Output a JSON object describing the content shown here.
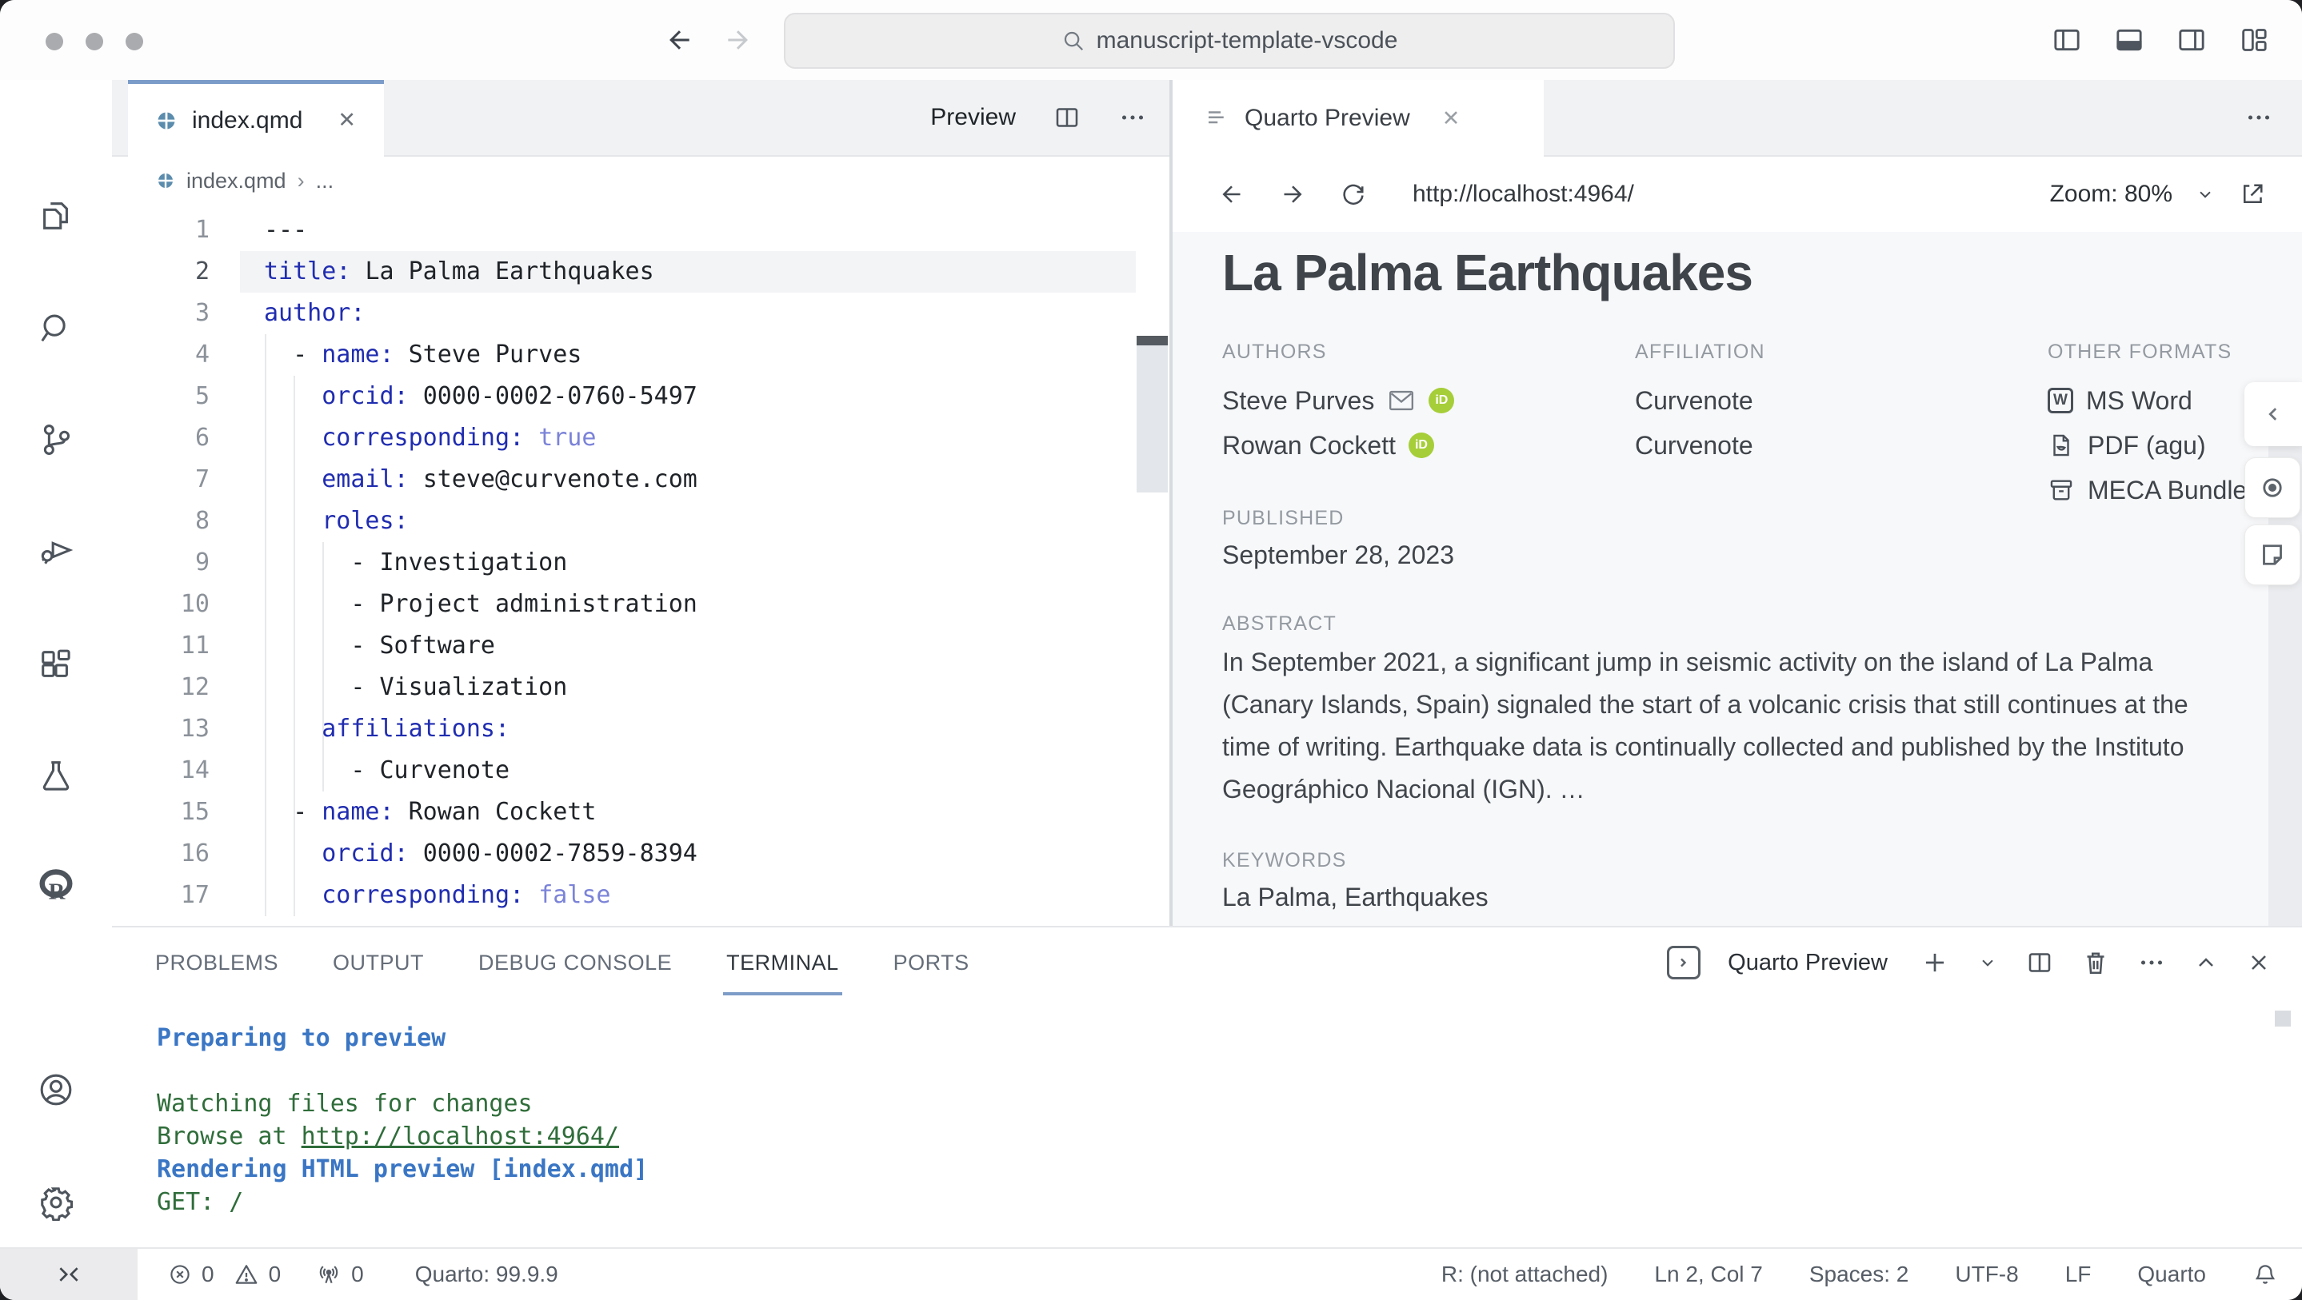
{
  "titlebar": {
    "search": "manuscript-template-vscode",
    "window_controls": [
      "close",
      "minimize",
      "zoom"
    ]
  },
  "activity_bar": {
    "items": [
      "explorer",
      "search",
      "source-control",
      "run-debug",
      "extensions",
      "testing",
      "r"
    ],
    "bottom_items": [
      "account",
      "settings"
    ]
  },
  "editor": {
    "tab_label": "index.qmd",
    "close_label": "✕",
    "breadcrumb_file": "index.qmd",
    "breadcrumb_sep": "›",
    "breadcrumb_more": "...",
    "preview_button": "Preview",
    "lines": [
      {
        "num": "1",
        "segs": [
          {
            "t": "---",
            "c": "plain"
          }
        ]
      },
      {
        "num": "2",
        "state": "active",
        "segs": [
          {
            "t": "title",
            "c": "key"
          },
          {
            "t": ": ",
            "c": "key"
          },
          {
            "t": "La Palma Earthquakes",
            "c": "plain"
          }
        ]
      },
      {
        "num": "3",
        "segs": [
          {
            "t": "author",
            "c": "key"
          },
          {
            "t": ":",
            "c": "key"
          }
        ]
      },
      {
        "num": "4",
        "segs": [
          {
            "t": "  - ",
            "c": "plain"
          },
          {
            "t": "name",
            "c": "key"
          },
          {
            "t": ": ",
            "c": "key"
          },
          {
            "t": "Steve Purves",
            "c": "plain"
          }
        ]
      },
      {
        "num": "5",
        "segs": [
          {
            "t": "    ",
            "c": "plain"
          },
          {
            "t": "orcid",
            "c": "key"
          },
          {
            "t": ": ",
            "c": "key"
          },
          {
            "t": "0000-0002-0760-5497",
            "c": "plain"
          }
        ]
      },
      {
        "num": "6",
        "segs": [
          {
            "t": "    ",
            "c": "plain"
          },
          {
            "t": "corresponding",
            "c": "key"
          },
          {
            "t": ": ",
            "c": "key"
          },
          {
            "t": "true",
            "c": "bool"
          }
        ]
      },
      {
        "num": "7",
        "segs": [
          {
            "t": "    ",
            "c": "plain"
          },
          {
            "t": "email",
            "c": "key"
          },
          {
            "t": ": ",
            "c": "key"
          },
          {
            "t": "steve@curvenote.com",
            "c": "plain"
          }
        ]
      },
      {
        "num": "8",
        "segs": [
          {
            "t": "    ",
            "c": "plain"
          },
          {
            "t": "roles",
            "c": "key"
          },
          {
            "t": ":",
            "c": "key"
          }
        ]
      },
      {
        "num": "9",
        "segs": [
          {
            "t": "      - Investigation",
            "c": "plain"
          }
        ]
      },
      {
        "num": "10",
        "segs": [
          {
            "t": "      - Project administration",
            "c": "plain"
          }
        ]
      },
      {
        "num": "11",
        "segs": [
          {
            "t": "      - Software",
            "c": "plain"
          }
        ]
      },
      {
        "num": "12",
        "segs": [
          {
            "t": "      - Visualization",
            "c": "plain"
          }
        ]
      },
      {
        "num": "13",
        "segs": [
          {
            "t": "    ",
            "c": "plain"
          },
          {
            "t": "affiliations",
            "c": "key"
          },
          {
            "t": ":",
            "c": "key"
          }
        ]
      },
      {
        "num": "14",
        "segs": [
          {
            "t": "      - Curvenote",
            "c": "plain"
          }
        ]
      },
      {
        "num": "15",
        "segs": [
          {
            "t": "  - ",
            "c": "plain"
          },
          {
            "t": "name",
            "c": "key"
          },
          {
            "t": ": ",
            "c": "key"
          },
          {
            "t": "Rowan Cockett",
            "c": "plain"
          }
        ]
      },
      {
        "num": "16",
        "segs": [
          {
            "t": "    ",
            "c": "plain"
          },
          {
            "t": "orcid",
            "c": "key"
          },
          {
            "t": ": ",
            "c": "key"
          },
          {
            "t": "0000-0002-7859-8394",
            "c": "plain"
          }
        ]
      },
      {
        "num": "17",
        "segs": [
          {
            "t": "    ",
            "c": "plain"
          },
          {
            "t": "corresponding",
            "c": "key"
          },
          {
            "t": ": ",
            "c": "key"
          },
          {
            "t": "false",
            "c": "bool"
          }
        ]
      }
    ]
  },
  "preview": {
    "tab_label": "Quarto Preview",
    "close_label": "✕",
    "url": "http://localhost:4964/",
    "zoom_label": "Zoom: 80%",
    "doc": {
      "title": "La Palma Earthquakes",
      "authors_label": "AUTHORS",
      "affiliation_label": "AFFILIATION",
      "formats_label": "OTHER FORMATS",
      "authors": [
        {
          "name": "Steve Purves",
          "icons": [
            "email-icon",
            "orcid-icon"
          ]
        },
        {
          "name": "Rowan Cockett",
          "icons": [
            "orcid-icon"
          ]
        }
      ],
      "orcid_badge": "iD",
      "affiliations": [
        "Curvenote",
        "Curvenote"
      ],
      "formats": [
        {
          "icon": "ms-word-icon",
          "icon_letter": "W",
          "label": "MS Word"
        },
        {
          "icon": "pdf-icon",
          "label": "PDF (agu)"
        },
        {
          "icon": "meca-icon",
          "label": "MECA Bundle"
        }
      ],
      "published_label": "PUBLISHED",
      "published": "September 28, 2023",
      "abstract_label": "ABSTRACT",
      "abstract": "In September 2021, a significant jump in seismic activity on the island of La Palma (Canary Islands, Spain) signaled the start of a volcanic crisis that still continues at the time of writing. Earthquake data is continually collected and published by the Instituto Geográphico Nacional (IGN). …",
      "keywords_label": "KEYWORDS",
      "keywords": "La Palma, Earthquakes"
    }
  },
  "panel": {
    "tabs": [
      {
        "label": "PROBLEMS"
      },
      {
        "label": "OUTPUT"
      },
      {
        "label": "DEBUG CONSOLE"
      },
      {
        "label": "TERMINAL",
        "state": "active"
      },
      {
        "label": "PORTS"
      }
    ],
    "terminal_session_label": "Quarto Preview",
    "terminal_lines": [
      {
        "segs": [
          {
            "t": "Preparing to preview",
            "c": "tblue"
          }
        ]
      },
      {
        "segs": [
          {
            "t": " ",
            "c": "tgreen"
          }
        ]
      },
      {
        "segs": [
          {
            "t": "Watching files for changes",
            "c": "tgreen"
          }
        ]
      },
      {
        "segs": [
          {
            "t": "Browse at ",
            "c": "tgreen"
          },
          {
            "t": "http://localhost:4964/",
            "c": "tlink"
          }
        ]
      },
      {
        "segs": [
          {
            "t": "Rendering HTML preview [index.qmd]",
            "c": "tblue"
          }
        ]
      },
      {
        "segs": [
          {
            "t": "GET: /",
            "c": "tgreen"
          }
        ]
      }
    ]
  },
  "statusbar": {
    "errors": "0",
    "warnings": "0",
    "ports": "0",
    "quarto_version": "Quarto: 99.9.9",
    "right_items": [
      "R: (not attached)",
      "Ln 2, Col 7",
      "Spaces: 2",
      "UTF-8",
      "LF",
      "Quarto"
    ]
  },
  "colors": {
    "accent_blue": "#7b9cc9",
    "yaml_key": "#202db0",
    "yaml_bool": "#7b83d8",
    "terminal_blue": "#3a76c4",
    "terminal_green": "#2f6d3a",
    "orcid_green": "#a6ce39",
    "quarto_icon_blue": "#5b8cad"
  }
}
